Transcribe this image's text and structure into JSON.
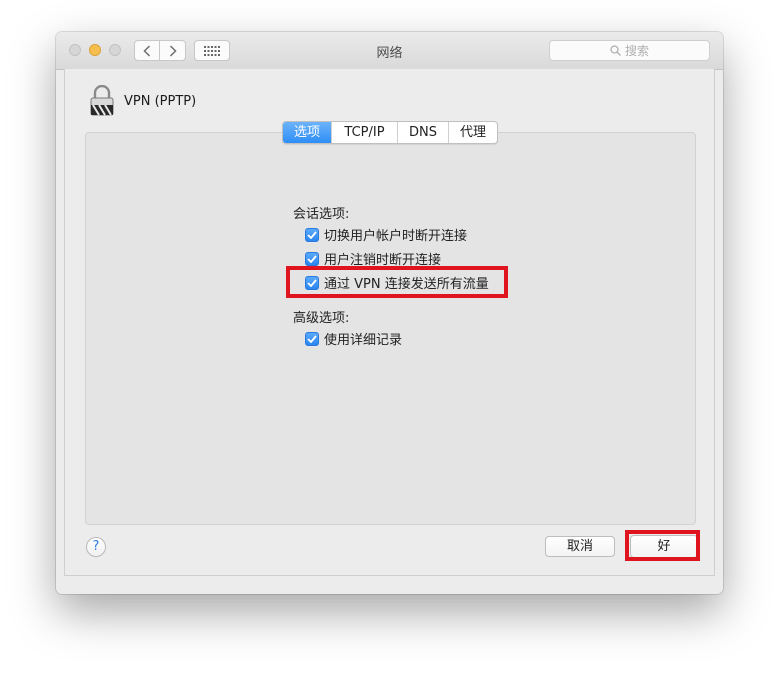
{
  "window": {
    "title": "网络",
    "search_placeholder": "搜索"
  },
  "header": {
    "icon": "vpn-lock-icon",
    "title": "VPN (PPTP)"
  },
  "tabs": [
    {
      "label": "选项",
      "active": true
    },
    {
      "label": "TCP/IP",
      "active": false
    },
    {
      "label": "DNS",
      "active": false
    },
    {
      "label": "代理",
      "active": false
    }
  ],
  "session_options": {
    "label": "会话选项:",
    "items": [
      {
        "label": "切换用户帐户时断开连接",
        "checked": true
      },
      {
        "label": "用户注销时断开连接",
        "checked": true
      },
      {
        "label": "通过 VPN 连接发送所有流量",
        "checked": true
      }
    ]
  },
  "advanced_options": {
    "label": "高级选项:",
    "items": [
      {
        "label": "使用详细记录",
        "checked": true
      }
    ]
  },
  "footer": {
    "help_label": "?",
    "cancel_label": "取消",
    "ok_label": "好"
  },
  "colors": {
    "accent": "#2d8ef6",
    "highlight": "#e0141e"
  }
}
